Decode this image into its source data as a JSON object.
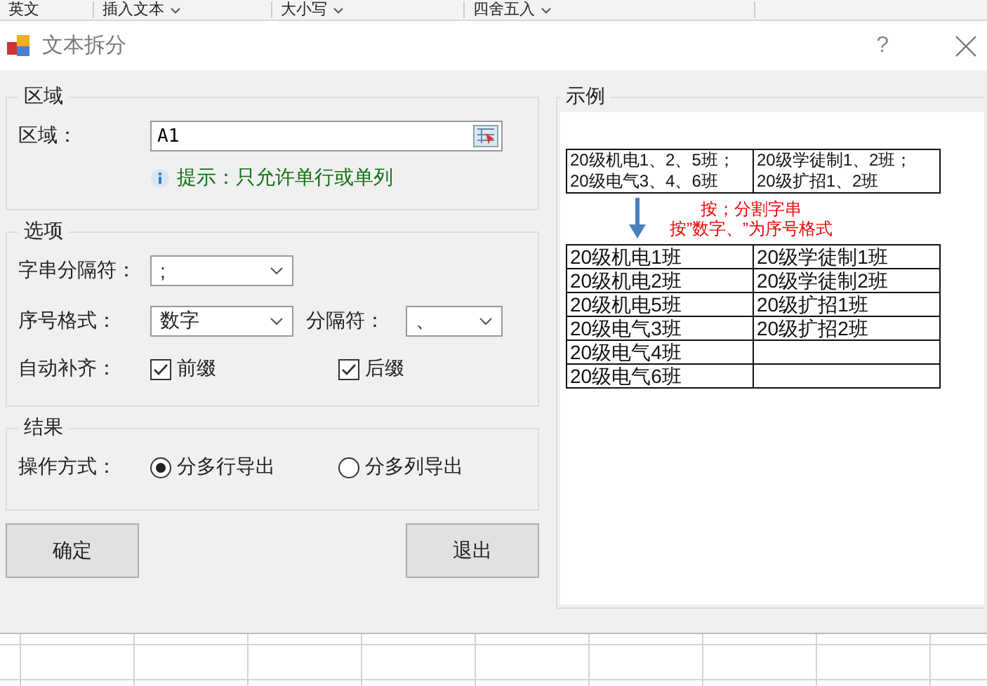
{
  "ribbon": {
    "items": [
      {
        "label": "英文",
        "kind": "text"
      },
      {
        "label": "插入文本",
        "kind": "dropdown"
      },
      {
        "label": "大小写",
        "kind": "dropdown"
      },
      {
        "label": "四舍五入",
        "kind": "dropdown"
      }
    ]
  },
  "window": {
    "title": "文本拆分",
    "help": "?"
  },
  "area": {
    "title": "区域",
    "label": "区域：",
    "value": "A1",
    "hint": "提示：只允许单行或单列"
  },
  "options": {
    "title": "选项",
    "rows": [
      {
        "label": "字串分隔符：",
        "value": ";"
      },
      {
        "label": "序号格式：",
        "value": "数字",
        "extra_label": "分隔符：",
        "extra_value": "、"
      }
    ],
    "autofill_label": "自动补齐：",
    "checkboxes": [
      {
        "label": "前缀",
        "checked": true
      },
      {
        "label": "后缀",
        "checked": true
      }
    ]
  },
  "result": {
    "title": "结果",
    "label": "操作方式：",
    "radios": [
      {
        "label": "分多行导出",
        "selected": true
      },
      {
        "label": "分多列导出",
        "selected": false
      }
    ]
  },
  "buttons": [
    "确定",
    "退出"
  ],
  "example": {
    "title": "示例",
    "source_rows": [
      [
        "20级机电1、2、5班；\n20级电气3、4、6班",
        "20级学徒制1、2班；\n20级扩招1、2班"
      ]
    ],
    "notes": [
      "按；分割字串",
      "按”数字、”为序号格式"
    ],
    "result_rows": [
      [
        "20级机电1班",
        "20级学徒制1班"
      ],
      [
        "20级机电2班",
        "20级学徒制2班"
      ],
      [
        "20级机电5班",
        "20级扩招1班"
      ],
      [
        "20级电气3班",
        "20级扩招2班"
      ],
      [
        "20级电气4班",
        ""
      ],
      [
        "20级电气6班",
        ""
      ]
    ]
  }
}
